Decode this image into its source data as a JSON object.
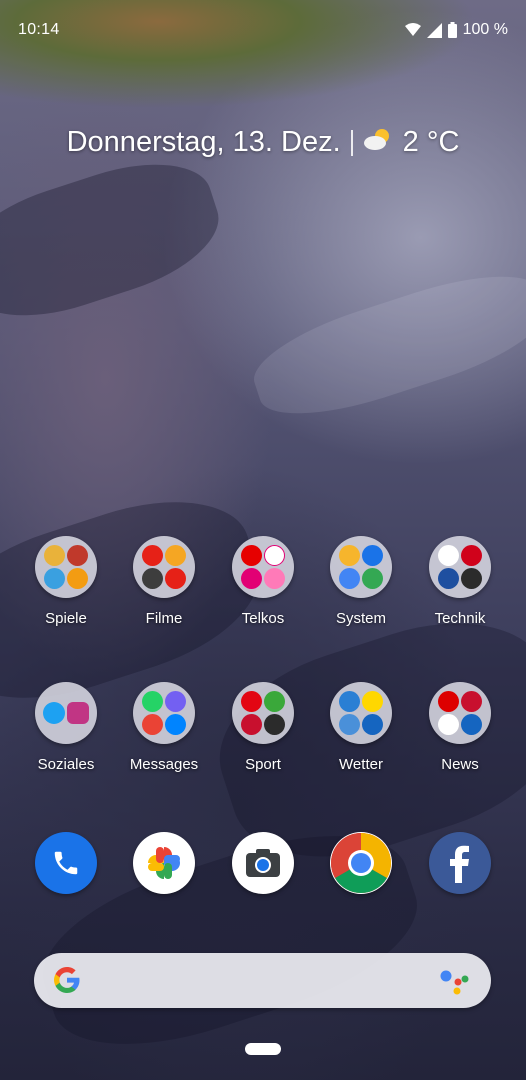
{
  "status_bar": {
    "time": "10:14",
    "battery": "100 %"
  },
  "glance": {
    "date": "Donnerstag, 13. Dez.",
    "temperature": "2 °C",
    "weather_icon": "partly-cloudy-icon"
  },
  "folders_row1": [
    {
      "label": "Spiele",
      "colors": [
        "#e9b23a",
        "#c0392b",
        "#3aa0e0",
        "#f39c12"
      ]
    },
    {
      "label": "Filme",
      "colors": [
        "#e62117",
        "#f5a623",
        "#3d3d3d",
        "#e62117"
      ]
    },
    {
      "label": "Telkos",
      "colors": [
        "#e60000",
        "#e20074",
        "#ffffff",
        "#e20074"
      ]
    },
    {
      "label": "System",
      "colors": [
        "#f6b52c",
        "#1a73e8",
        "#4285f4",
        "#34a853"
      ]
    },
    {
      "label": "Technik",
      "colors": [
        "#ffffff",
        "#d0021b",
        "#1e4fa0",
        "#2b2b2b"
      ]
    }
  ],
  "folders_row2": [
    {
      "label": "Soziales",
      "colors": [
        "#1da1f2",
        "#c13584",
        "#d8d8e0",
        "#d8d8e0"
      ]
    },
    {
      "label": "Messages",
      "colors": [
        "#25d366",
        "#7360f2",
        "#ea4335",
        "#0084ff"
      ]
    },
    {
      "label": "Sport",
      "colors": [
        "#e30613",
        "#3aa83a",
        "#c8102e",
        "#2b2b2b"
      ]
    },
    {
      "label": "Wetter",
      "colors": [
        "#2a7fd4",
        "#ffd700",
        "#4a90d9",
        "#1565c0"
      ]
    },
    {
      "label": "News",
      "colors": [
        "#dd0000",
        "#c8102e",
        "#ffffff",
        "#1565c0"
      ]
    }
  ],
  "dock": [
    {
      "name": "phone-app-icon",
      "bg": "#1a73e8"
    },
    {
      "name": "google-photos-icon",
      "bg": "#ffffff"
    },
    {
      "name": "camera-app-icon",
      "bg": "#ffffff"
    },
    {
      "name": "chrome-icon",
      "bg": "#ffffff"
    },
    {
      "name": "facebook-icon",
      "bg": "#3b5998"
    }
  ],
  "search_bar": {
    "logo": "google-g-icon",
    "assistant": "assistant-dots-icon"
  }
}
